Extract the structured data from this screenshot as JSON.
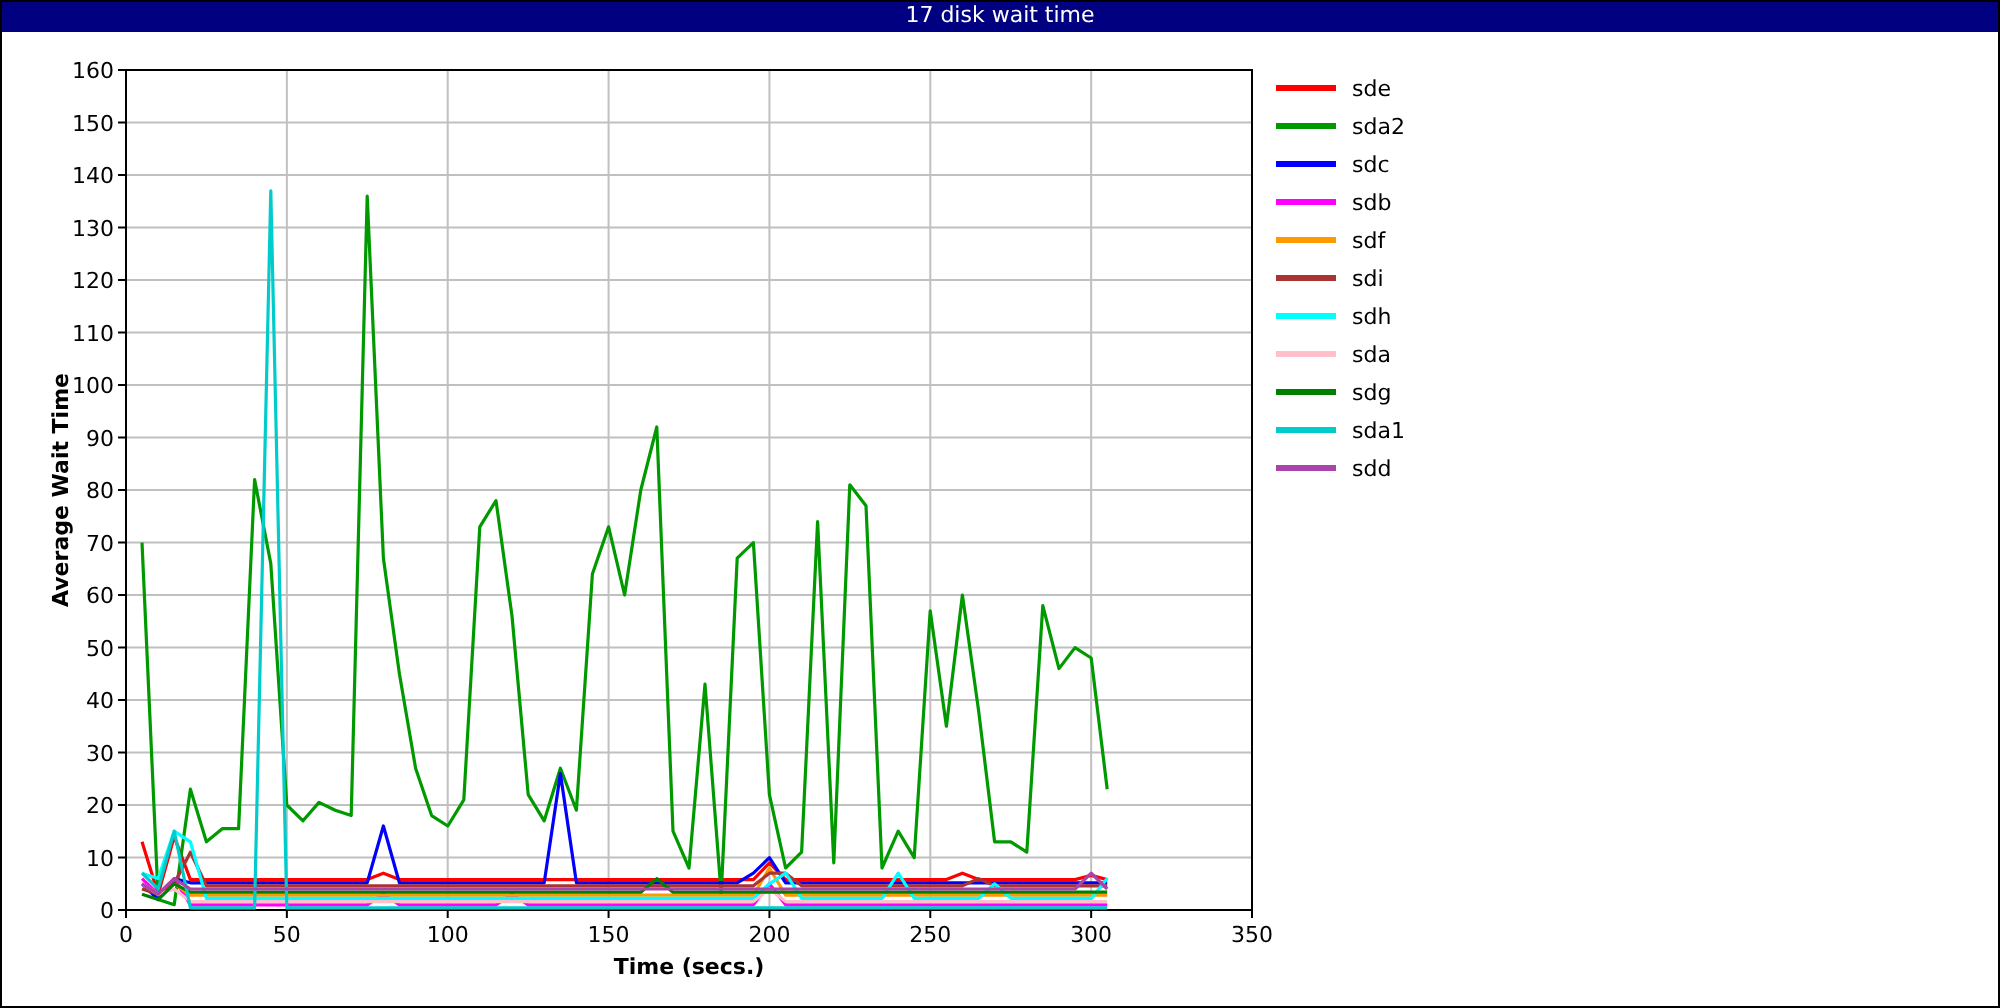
{
  "window": {
    "title": "17 disk wait time"
  },
  "chart_data": {
    "type": "line",
    "xlabel": "Time (secs.)",
    "ylabel": "Average Wait Time",
    "xlim": [
      0,
      350
    ],
    "ylim": [
      0,
      160
    ],
    "xticks": [
      0,
      50,
      100,
      150,
      200,
      250,
      300,
      350
    ],
    "yticks": [
      0,
      10,
      20,
      30,
      40,
      50,
      60,
      70,
      80,
      90,
      100,
      110,
      120,
      130,
      140,
      150,
      160
    ],
    "grid": true,
    "legend": true,
    "x": [
      5,
      10,
      15,
      20,
      25,
      30,
      35,
      40,
      45,
      50,
      55,
      60,
      65,
      70,
      75,
      80,
      85,
      90,
      95,
      100,
      105,
      110,
      115,
      120,
      125,
      130,
      135,
      140,
      145,
      150,
      155,
      160,
      165,
      170,
      175,
      180,
      185,
      190,
      195,
      200,
      205,
      210,
      215,
      220,
      225,
      230,
      235,
      240,
      245,
      250,
      255,
      260,
      265,
      270,
      275,
      280,
      285,
      290,
      295,
      300,
      305
    ],
    "series": [
      {
        "name": "sde",
        "color": "#ff0000",
        "values": [
          13,
          3,
          14,
          5.8,
          5.8,
          5.8,
          5.8,
          5.8,
          5.8,
          5.8,
          5.8,
          5.8,
          5.8,
          5.8,
          5.8,
          7,
          5.8,
          5.8,
          5.8,
          5.8,
          5.8,
          5.8,
          5.8,
          5.8,
          5.8,
          5.8,
          5.8,
          5.8,
          5.8,
          5.8,
          5.8,
          5.8,
          5.8,
          5.8,
          5.8,
          5.8,
          5.8,
          5.8,
          5.8,
          9,
          5.8,
          5.8,
          5.8,
          5.8,
          5.8,
          5.8,
          5.8,
          5.8,
          5.8,
          5.8,
          5.8,
          7,
          5.8,
          5.8,
          5.8,
          5.8,
          5.8,
          5.8,
          5.8,
          6.6,
          5.8
        ]
      },
      {
        "name": "sda2",
        "color": "#009900",
        "values": [
          70,
          2,
          1,
          23,
          13,
          15.5,
          15.5,
          82,
          66,
          20,
          17,
          20.5,
          19,
          18,
          136,
          67,
          45,
          27,
          18,
          16,
          21,
          73,
          78,
          56,
          22,
          17,
          27,
          19,
          64,
          73,
          60,
          80,
          92,
          15,
          8,
          43,
          3,
          67,
          70,
          22,
          8,
          11,
          74,
          9,
          81,
          77,
          8,
          15,
          10,
          57,
          35,
          60,
          38,
          13,
          13,
          11,
          58,
          46,
          50,
          48,
          23
        ]
      },
      {
        "name": "sdc",
        "color": "#0000ff",
        "values": [
          5,
          2,
          6,
          5.2,
          5.2,
          5.2,
          5.2,
          5.2,
          5.2,
          5.2,
          5.2,
          5.2,
          5.2,
          5.2,
          5.2,
          16,
          5.2,
          5.2,
          5.2,
          5.2,
          5.2,
          5.2,
          5.2,
          5.2,
          5.2,
          5.2,
          26,
          5.2,
          5.2,
          5.2,
          5.2,
          5.2,
          5.2,
          5.2,
          5.2,
          5.2,
          5.2,
          5.2,
          7,
          10,
          5.2,
          5.2,
          5.2,
          5.2,
          5.2,
          5.2,
          5.2,
          5.2,
          5.2,
          5.2,
          5.2,
          5.2,
          5.2,
          5.2,
          5.2,
          5.2,
          5.2,
          5.2,
          5.2,
          5.2,
          5.2
        ]
      },
      {
        "name": "sdb",
        "color": "#ff00ff",
        "values": [
          6,
          3,
          6,
          1,
          1,
          1,
          1,
          1,
          1,
          1,
          1,
          1,
          1,
          1,
          1,
          3,
          1,
          1,
          1,
          1,
          1,
          1,
          1,
          3,
          1,
          1,
          1,
          1,
          1,
          1,
          1,
          1,
          1,
          1,
          1,
          1,
          1,
          1,
          1,
          5,
          1,
          1,
          1,
          1,
          1,
          1,
          1,
          1,
          1,
          1,
          1,
          1,
          1,
          1,
          1,
          1,
          1,
          1,
          1,
          1,
          1
        ]
      },
      {
        "name": "sdf",
        "color": "#ff9900",
        "values": [
          5,
          3,
          5,
          2.8,
          2.8,
          2.8,
          2.8,
          2.8,
          2.8,
          2.8,
          2.8,
          2.8,
          2.8,
          2.8,
          2.8,
          2.8,
          2.8,
          2.8,
          2.8,
          2.8,
          2.8,
          2.8,
          2.8,
          2.8,
          2.8,
          2.8,
          2.8,
          2.8,
          2.8,
          2.8,
          2.8,
          2.8,
          2.8,
          2.8,
          2.8,
          2.8,
          2.8,
          2.8,
          2.8,
          8,
          2.8,
          2.8,
          2.8,
          2.8,
          2.8,
          2.8,
          2.8,
          2.8,
          2.8,
          2.8,
          2.8,
          2.8,
          2.8,
          2.8,
          2.8,
          2.8,
          2.8,
          2.8,
          2.8,
          2.8,
          2.8
        ]
      },
      {
        "name": "sdi",
        "color": "#aa3333",
        "values": [
          4,
          3,
          5,
          11,
          4.6,
          4.6,
          4.6,
          4.6,
          4.6,
          4.6,
          4.6,
          4.6,
          4.6,
          4.6,
          4.6,
          4.6,
          4.6,
          4.6,
          4.6,
          4.6,
          4.6,
          4.6,
          4.6,
          4.6,
          4.6,
          4.6,
          4.6,
          4.6,
          4.6,
          4.6,
          4.6,
          4.6,
          4.6,
          4.6,
          4.6,
          4.6,
          4.6,
          4.6,
          4.6,
          7,
          7,
          4.6,
          4.6,
          4.6,
          4.6,
          4.6,
          4.6,
          4.6,
          4.6,
          4.6,
          4.6,
          4.6,
          6,
          4.6,
          4.6,
          4.6,
          4.6,
          4.6,
          4.6,
          4.6,
          4.6
        ]
      },
      {
        "name": "sdh",
        "color": "#00ffff",
        "values": [
          7,
          6,
          15,
          13,
          2.2,
          2.2,
          2.2,
          2.2,
          2.2,
          2.2,
          2.2,
          2.2,
          2.2,
          2.2,
          2.2,
          2.2,
          2.2,
          2.2,
          2.2,
          2.2,
          2.2,
          2.2,
          2.2,
          2.2,
          2.2,
          2.2,
          2.2,
          2.2,
          2.2,
          2.2,
          2.2,
          2.2,
          2.2,
          2.2,
          2.2,
          2.2,
          2.2,
          2.2,
          2.2,
          5,
          7,
          2.2,
          2.2,
          2.2,
          2.2,
          2.2,
          2.2,
          7,
          2.2,
          2.2,
          2.2,
          2.2,
          2.2,
          5,
          2.2,
          2.2,
          2.2,
          2.2,
          2.2,
          2.2,
          6
        ]
      },
      {
        "name": "sda",
        "color": "#ffc0cb",
        "values": [
          5,
          3,
          4,
          1.6,
          1.6,
          1.6,
          1.6,
          1.6,
          1.6,
          1.6,
          1.6,
          1.6,
          1.6,
          1.6,
          1.6,
          1.6,
          1.6,
          1.6,
          1.6,
          1.6,
          1.6,
          1.6,
          1.6,
          1.6,
          1.6,
          1.6,
          1.6,
          1.6,
          1.6,
          1.6,
          1.6,
          1.6,
          1.6,
          1.6,
          1.6,
          1.6,
          1.6,
          1.6,
          1.6,
          4,
          1.6,
          1.6,
          1.6,
          1.6,
          1.6,
          1.6,
          1.6,
          1.6,
          1.6,
          1.6,
          1.6,
          1.6,
          1.6,
          1.6,
          1.6,
          1.6,
          1.6,
          1.6,
          1.6,
          1.6,
          1.6
        ]
      },
      {
        "name": "sdg",
        "color": "#008000",
        "values": [
          3,
          2,
          5,
          3.4,
          3.4,
          3.4,
          3.4,
          3.4,
          3.4,
          3.4,
          3.4,
          3.4,
          3.4,
          3.4,
          3.4,
          3.4,
          3.4,
          3.4,
          3.4,
          3.4,
          3.4,
          3.4,
          3.4,
          3.4,
          3.4,
          3.4,
          3.4,
          3.4,
          3.4,
          3.4,
          3.4,
          3.4,
          6,
          3.4,
          3.4,
          3.4,
          3.4,
          3.4,
          3.4,
          3.4,
          3.4,
          3.4,
          3.4,
          3.4,
          3.4,
          3.4,
          3.4,
          3.4,
          3.4,
          3.4,
          3.4,
          3.4,
          3.4,
          3.4,
          3.4,
          3.4,
          3.4,
          3.4,
          3.4,
          3.4,
          3.4
        ]
      },
      {
        "name": "sda1",
        "color": "#00cccc",
        "values": [
          7,
          4,
          15,
          0.4,
          0.4,
          0.4,
          0.4,
          0.4,
          137,
          0.4,
          0.4,
          0.4,
          0.4,
          0.4,
          0.4,
          0.4,
          0.4,
          0.4,
          0.4,
          0.4,
          0.4,
          0.4,
          0.4,
          0.4,
          0.4,
          0.4,
          0.4,
          0.4,
          0.4,
          0.4,
          0.4,
          0.4,
          0.4,
          0.4,
          0.4,
          0.4,
          0.4,
          0.4,
          0.4,
          0.4,
          0.4,
          0.4,
          0.4,
          0.4,
          0.4,
          0.4,
          0.4,
          0.4,
          0.4,
          0.4,
          0.4,
          0.4,
          0.4,
          0.4,
          0.4,
          0.4,
          0.4,
          0.4,
          0.4,
          0.4,
          0.4
        ]
      },
      {
        "name": "sdd",
        "color": "#aa44aa",
        "values": [
          5,
          3,
          6,
          4,
          4,
          4,
          4,
          4,
          4,
          4,
          4,
          4,
          4,
          4,
          4,
          4,
          4,
          4,
          4,
          4,
          4,
          4,
          4,
          4,
          4,
          4,
          4,
          4,
          4,
          4,
          4,
          4,
          4,
          4,
          4,
          4,
          4,
          4,
          4,
          4,
          4,
          4,
          4,
          4,
          4,
          4,
          4,
          4,
          4,
          4,
          4,
          4,
          4,
          4,
          4,
          4,
          4,
          4,
          4,
          7,
          4
        ]
      }
    ]
  }
}
